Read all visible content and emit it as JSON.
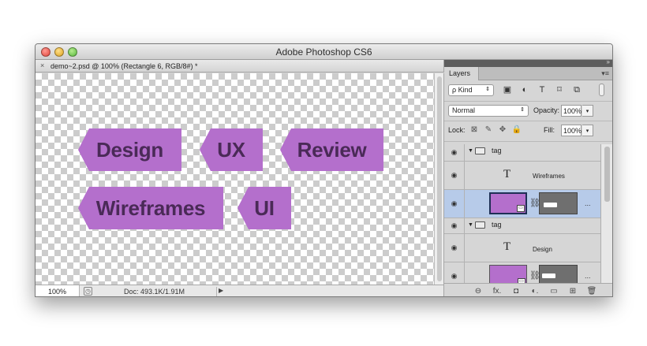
{
  "window": {
    "title": "Adobe Photoshop CS6"
  },
  "document": {
    "tab_close": "×",
    "tab_label": "demo~2.psd @ 100% (Rectangle 6, RGB/8#) *",
    "tags": [
      {
        "text": "Design"
      },
      {
        "text": "UX"
      },
      {
        "text": "Review"
      },
      {
        "text": "Wireframes"
      },
      {
        "text": "UI"
      }
    ],
    "tag_color": "#b46fcc",
    "tag_text_color": "#4a2a57"
  },
  "statusbar": {
    "zoom": "100%",
    "doc_size": "Doc: 493.1K/1.91M",
    "arrow": "▶"
  },
  "layers_panel": {
    "collapse_glyph": "»",
    "tab_label": "Layers",
    "menu_glyph": "▾≡",
    "kind_label": "Kind",
    "kind_search_glyph": "ρ",
    "filter_icons": [
      "image-filter-icon",
      "adjustment-filter-icon",
      "type-filter-icon",
      "shape-filter-icon",
      "smart-object-filter-icon"
    ],
    "filter_glyphs": [
      "▣",
      "◐",
      "T",
      "⌑",
      "⧉"
    ],
    "blend_mode": "Normal",
    "opacity_label": "Opacity:",
    "opacity_value": "100%",
    "lock_label": "Lock:",
    "lock_glyphs": [
      "⊠",
      "✎",
      "✥",
      "🔒"
    ],
    "fill_label": "Fill:",
    "fill_value": "100%",
    "dropdown_glyph": "▾",
    "eye_glyph": "◉",
    "groups": [
      {
        "name": "tag",
        "type_layer": "Wireframes"
      },
      {
        "name": "tag",
        "type_layer": "Design"
      }
    ],
    "type_glyph": "T",
    "chain_glyph": "⛓",
    "ellipsis": "...",
    "footer_glyphs": [
      "⊖",
      "fx.",
      "◘",
      "◐.",
      "▭",
      "⊞",
      "🗑"
    ]
  }
}
